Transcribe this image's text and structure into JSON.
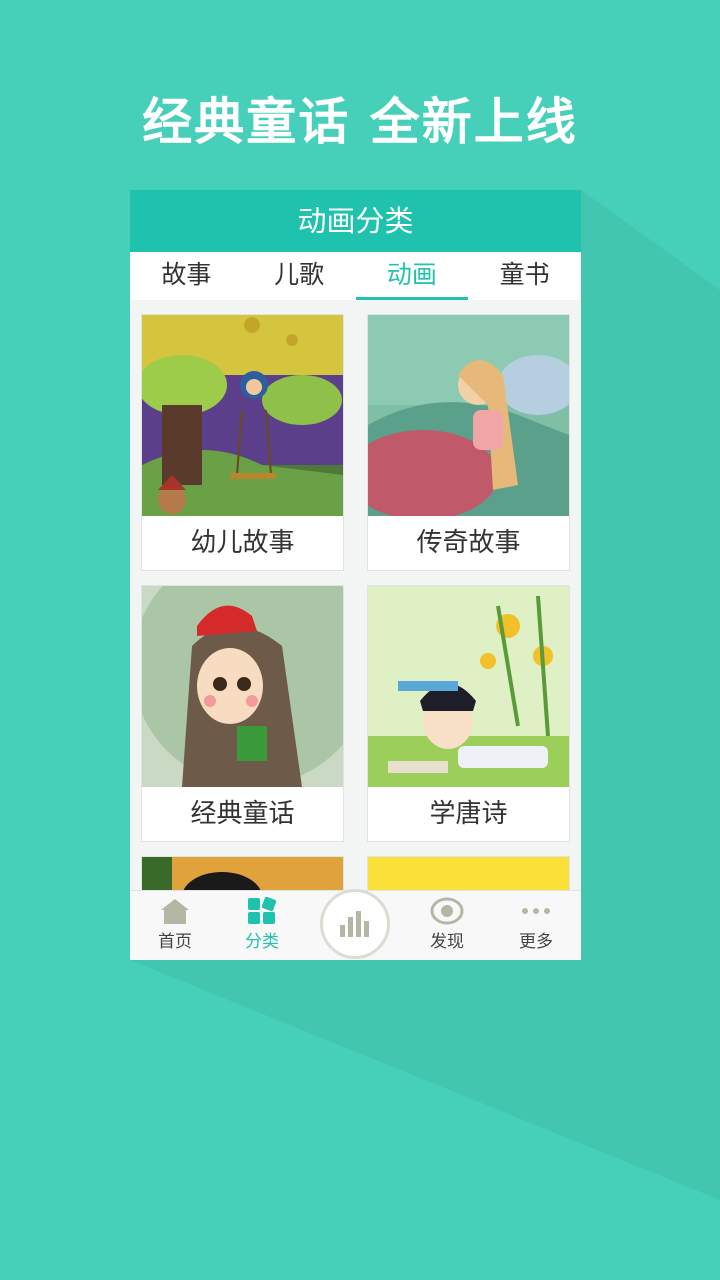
{
  "headline": "经典童话 全新上线",
  "screen": {
    "title": "动画分类",
    "tabs": [
      {
        "label": "故事",
        "active": false
      },
      {
        "label": "儿歌",
        "active": false
      },
      {
        "label": "动画",
        "active": true
      },
      {
        "label": "童书",
        "active": false
      }
    ],
    "cards": [
      {
        "label": "幼儿故事"
      },
      {
        "label": "传奇故事"
      },
      {
        "label": "经典童话"
      },
      {
        "label": "学唐诗"
      }
    ],
    "bottom_nav": [
      {
        "label": "首页",
        "icon": "home-icon"
      },
      {
        "label": "分类",
        "icon": "category-icon",
        "active": true
      },
      {
        "label": "",
        "icon": "play-bars-icon"
      },
      {
        "label": "发现",
        "icon": "eye-icon"
      },
      {
        "label": "更多",
        "icon": "more-dots-icon"
      }
    ]
  },
  "colors": {
    "background": "#46cfb9",
    "accent": "#1fc2ad"
  }
}
